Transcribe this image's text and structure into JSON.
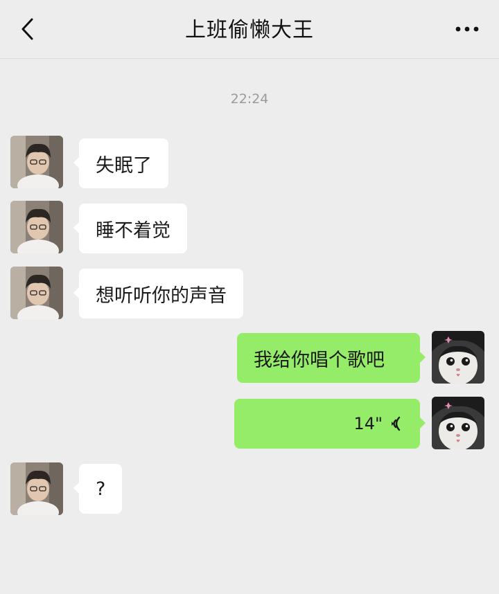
{
  "header": {
    "title": "上班偷懒大王",
    "back_icon": "chevron-left-icon",
    "more_icon": "more-dots-icon"
  },
  "timestamp": "22:24",
  "messages": [
    {
      "side": "in",
      "text": "失眠了"
    },
    {
      "side": "in",
      "text": "睡不着觉"
    },
    {
      "side": "in",
      "text": "想听听你的声音"
    },
    {
      "side": "out",
      "text": "我给你唱个歌吧"
    },
    {
      "side": "out",
      "type": "voice",
      "duration": "14\"",
      "icon": "voice-wave-icon"
    },
    {
      "side": "in",
      "text": "?"
    }
  ],
  "colors": {
    "background": "#ededed",
    "incoming_bubble": "#ffffff",
    "outgoing_bubble": "#95ec69"
  }
}
